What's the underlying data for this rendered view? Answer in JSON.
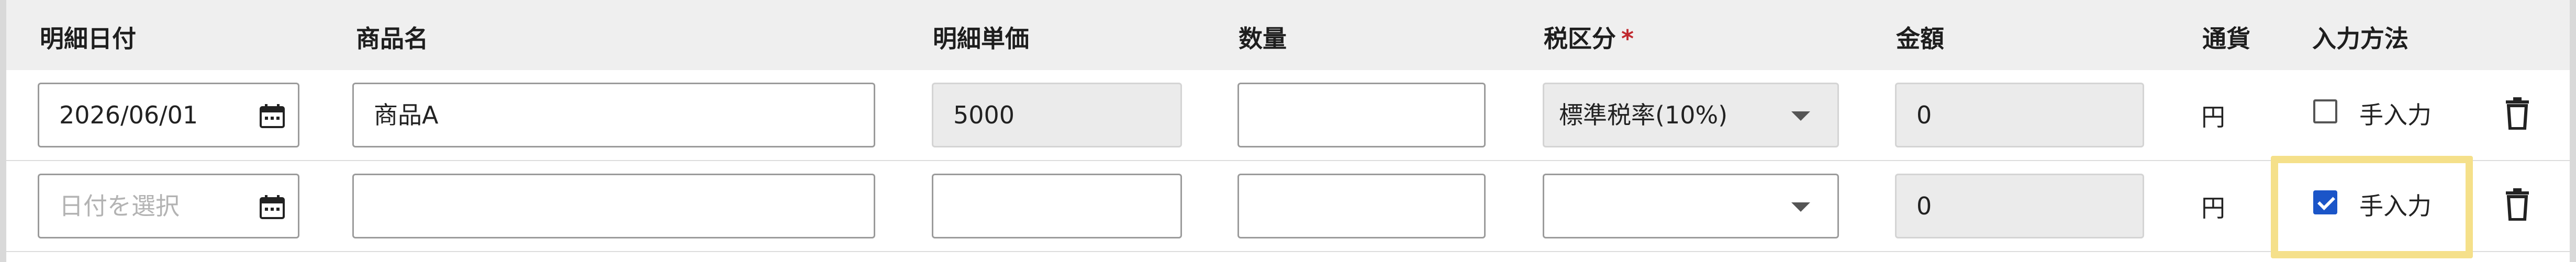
{
  "header": {
    "date": "明細日付",
    "product": "商品名",
    "unit_price": "明細単価",
    "quantity": "数量",
    "tax": "税区分",
    "tax_required_mark": "*",
    "amount": "金額",
    "currency": "通貨",
    "input_method": "入力方法"
  },
  "rows": [
    {
      "date_value": "2026/06/01",
      "product_value": "商品A",
      "unit_price_value": "5000",
      "quantity_value": "",
      "tax_value": "標準税率(10%)",
      "amount_value": "0",
      "currency": "円",
      "manual_label": "手入力",
      "manual_checked": false
    },
    {
      "date_placeholder": "日付を選択",
      "product_value": "",
      "unit_price_value": "",
      "quantity_value": "",
      "tax_value": "",
      "amount_value": "0",
      "currency": "円",
      "manual_label": "手入力",
      "manual_checked": true
    }
  ],
  "colors": {
    "checkbox_checked": "#1b55c8",
    "required_mark": "#c0282e",
    "highlight": "#f5e08a"
  },
  "icons": [
    "calendar-icon",
    "dropdown-arrow-icon",
    "trash-icon"
  ]
}
